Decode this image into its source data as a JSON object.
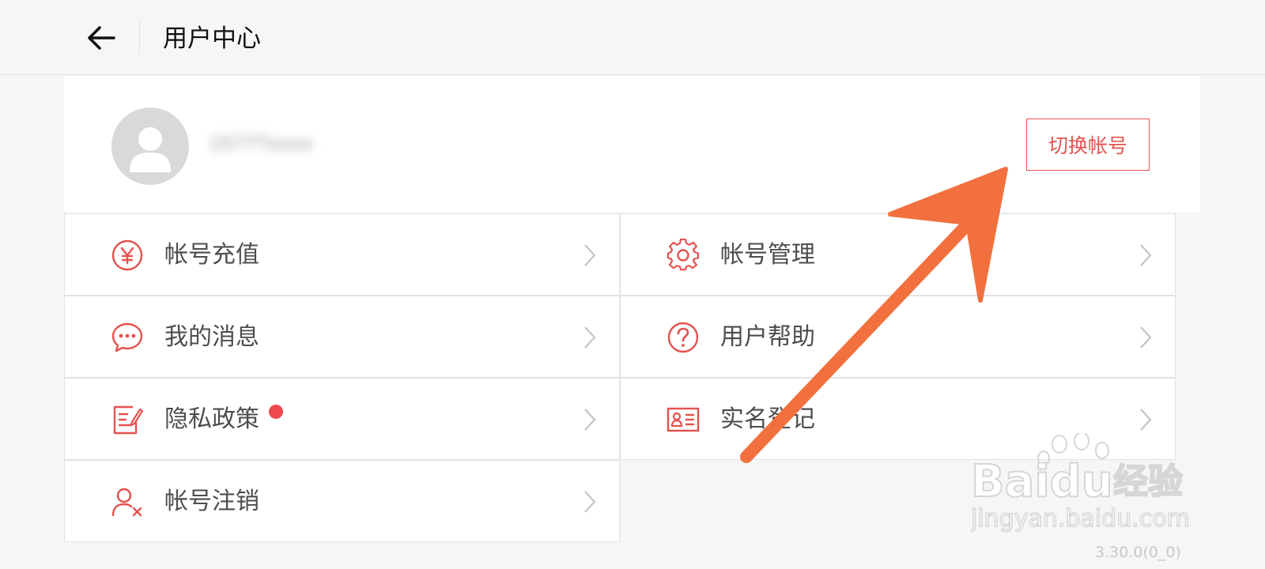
{
  "header": {
    "title": "用户中心",
    "back_icon": "arrow-left-icon"
  },
  "profile": {
    "username": "15777xxxx",
    "username_note_blurred": true,
    "avatar_icon": "user-avatar-icon",
    "switch_account_label": "切换帐号"
  },
  "menu": {
    "left": [
      {
        "label": "帐号充值",
        "icon": "yuan-coin-icon"
      },
      {
        "label": "我的消息",
        "icon": "chat-bubble-icon"
      },
      {
        "label": "隐私政策",
        "icon": "document-edit-icon",
        "badge_dot": true
      },
      {
        "label": "帐号注销",
        "icon": "user-remove-icon"
      }
    ],
    "right": [
      {
        "label": "帐号管理",
        "icon": "gear-icon"
      },
      {
        "label": "用户帮助",
        "icon": "question-icon"
      },
      {
        "label": "实名登记",
        "icon": "id-card-icon"
      }
    ]
  },
  "watermark": {
    "brand": "Baidu",
    "brand_cn": "经验",
    "url": "jingyan.baidu.com"
  },
  "version": "3.30.0(0_0)",
  "colors": {
    "accent": "#e5524f",
    "arrow": "#f2703e",
    "dot": "#f04a50"
  }
}
